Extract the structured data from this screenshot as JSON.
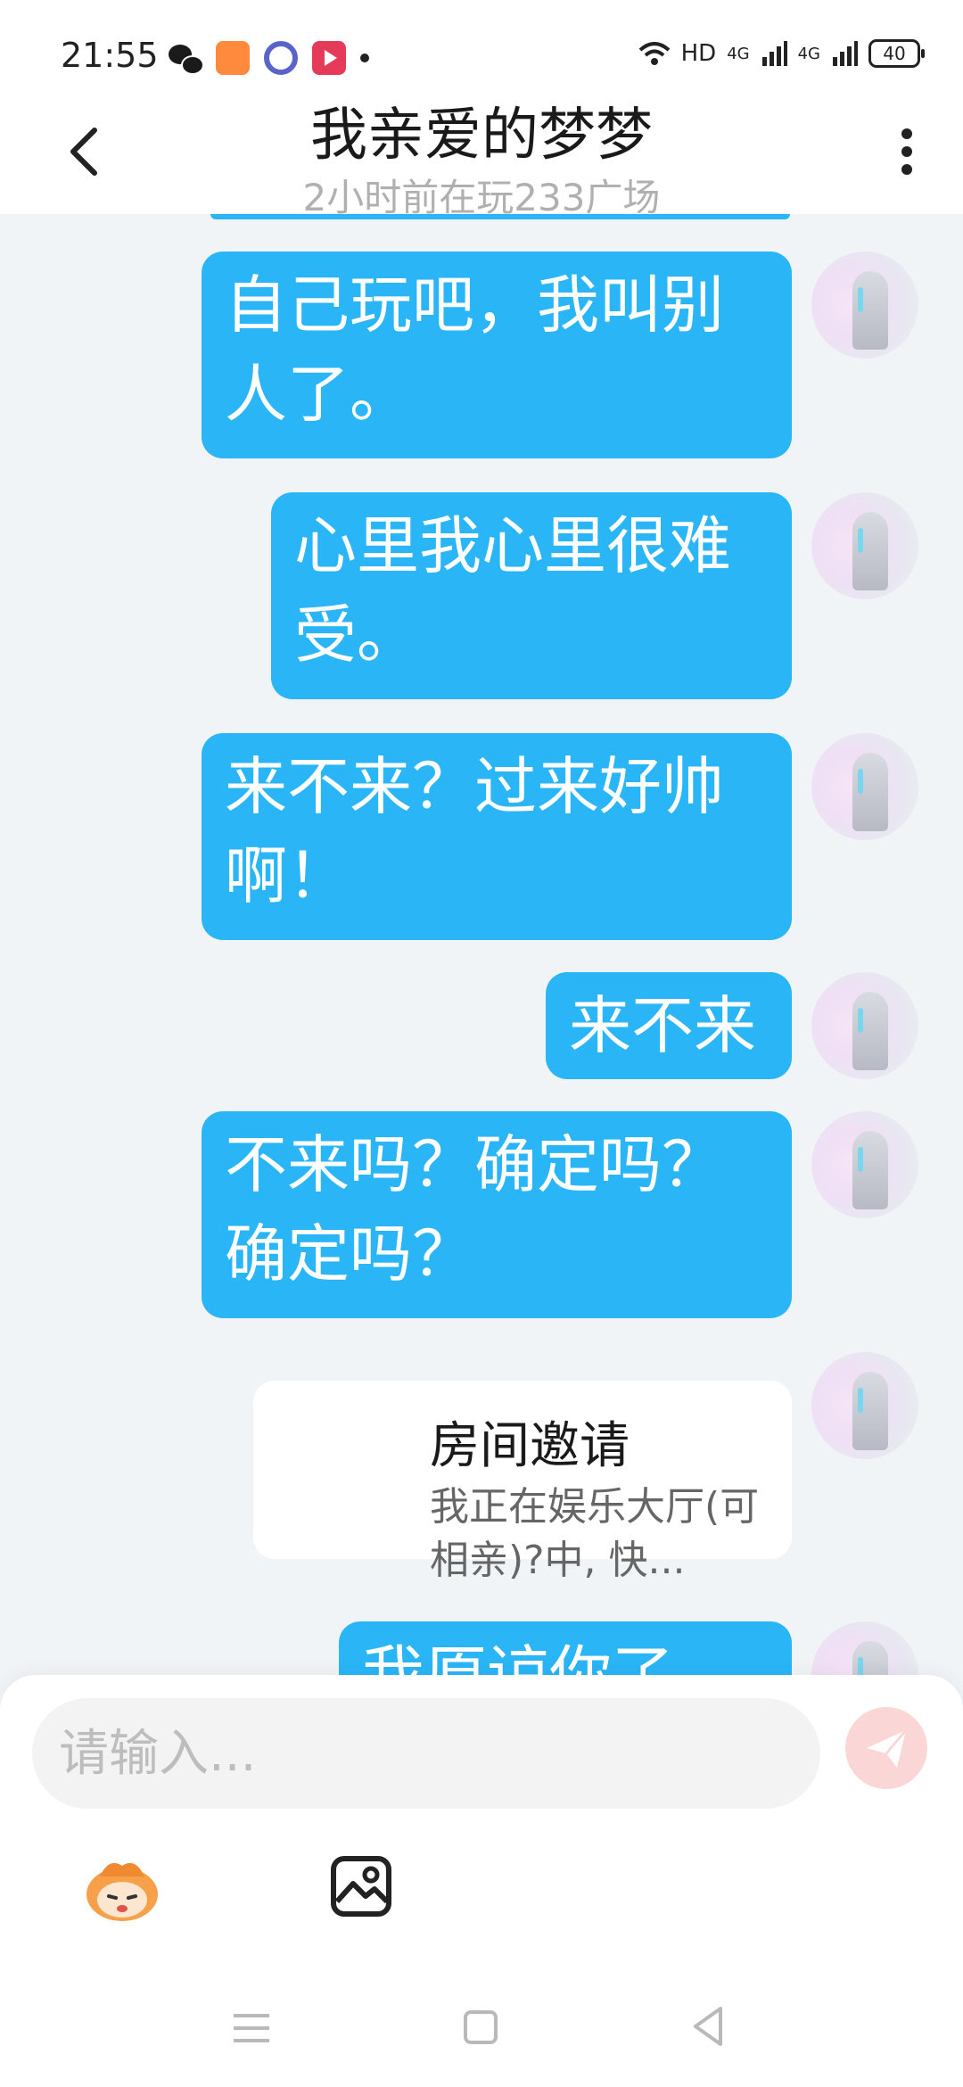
{
  "status_bar": {
    "time": "21:55",
    "network": "HD",
    "signal1": "4G",
    "signal2": "4G",
    "battery": "40"
  },
  "header": {
    "title": "我亲爱的梦梦",
    "subtitle": "2小时前在玩233广场"
  },
  "messages": [
    {
      "type": "text",
      "text": "自己玩吧，我叫别人了。"
    },
    {
      "type": "text",
      "text": "心里我心里很难受。"
    },
    {
      "type": "text",
      "text": "来不来？过来好帅啊！"
    },
    {
      "type": "text",
      "text": "来不来"
    },
    {
      "type": "text",
      "text": "不来吗？确定吗？确定吗？"
    },
    {
      "type": "invite",
      "title": "房间邀请",
      "desc": "我正在娱乐大厅(可相亲)?中, 快..."
    },
    {
      "type": "text",
      "text": "我原谅你了。"
    }
  ],
  "input": {
    "placeholder": "请输入...",
    "value": ""
  },
  "colors": {
    "bubble": "#2ab5f6",
    "send_disabled": "#fbd6d6",
    "background": "#f1f4f7"
  },
  "icons": [
    "back-icon",
    "more-icon",
    "send-icon",
    "emoji-icon",
    "image-icon",
    "nav-menu-icon",
    "nav-home-icon",
    "nav-back-icon"
  ]
}
